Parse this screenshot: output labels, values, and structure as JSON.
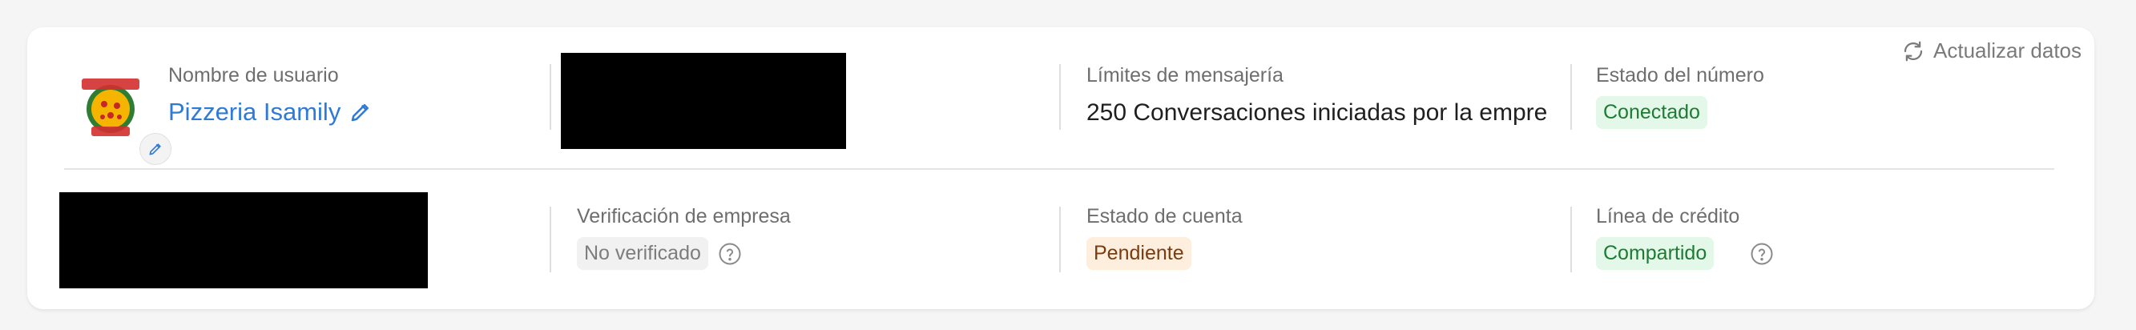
{
  "header": {
    "refresh_label": "Actualizar datos"
  },
  "profile": {
    "username_label": "Nombre de usuario",
    "username": "Pizzeria Isamily"
  },
  "messaging": {
    "label": "Límites de mensajería",
    "value": "250 Conversaciones iniciadas por la empre"
  },
  "number_status": {
    "label": "Estado del número",
    "badge": "Conectado"
  },
  "business_verification": {
    "label": "Verificación de empresa",
    "badge": "No verificado"
  },
  "account_status": {
    "label": "Estado de cuenta",
    "badge": "Pendiente"
  },
  "credit_line": {
    "label": "Línea de crédito",
    "badge": "Compartido"
  },
  "colors": {
    "link": "#2f7ad6",
    "success_bg": "#e3f8e8",
    "warning_bg": "#fdeedd",
    "neutral_bg": "#f1f1f1"
  },
  "icons": {
    "refresh": "refresh-icon",
    "edit": "pencil-icon",
    "help": "help-circle-icon"
  }
}
